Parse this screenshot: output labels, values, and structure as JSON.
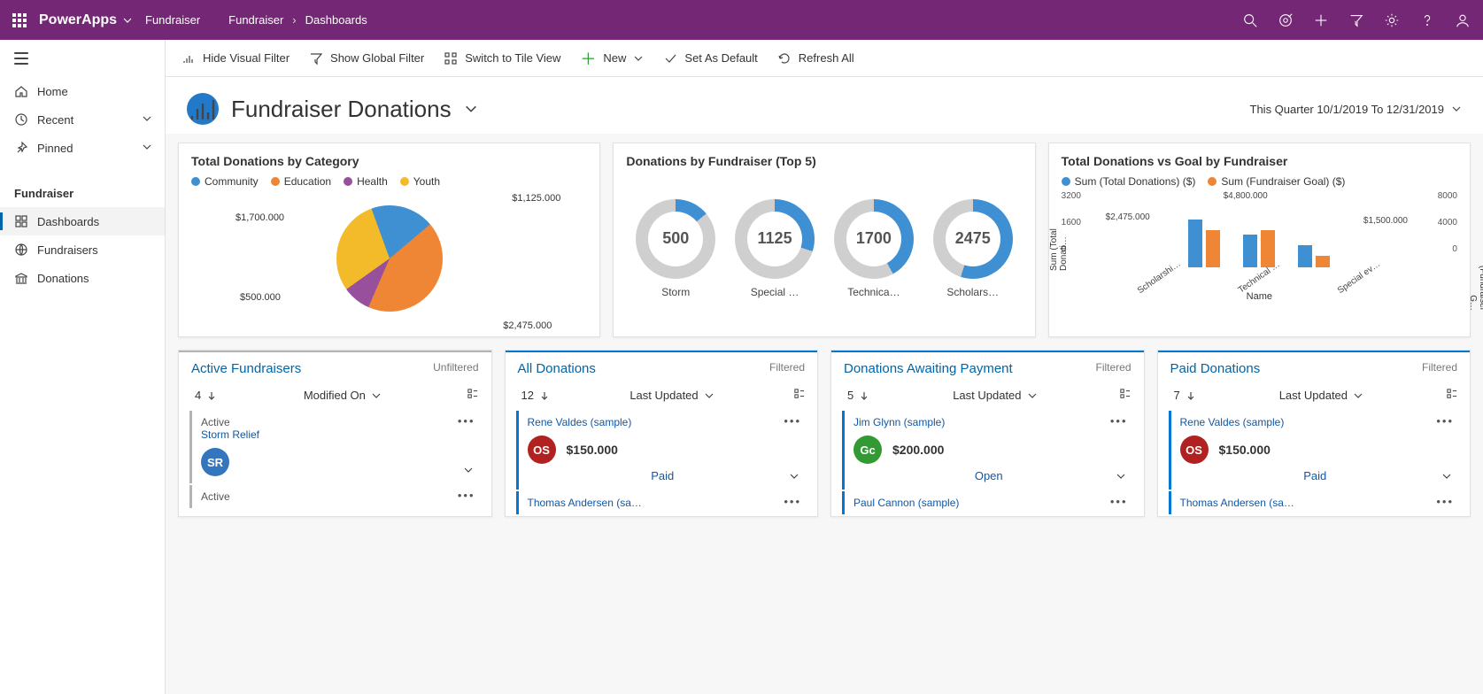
{
  "topbar": {
    "brand": "PowerApps",
    "app_name": "Fundraiser",
    "breadcrumb": [
      "Fundraiser",
      "Dashboards"
    ]
  },
  "sidebar": {
    "home": "Home",
    "recent": "Recent",
    "pinned": "Pinned",
    "section": "Fundraiser",
    "items": [
      {
        "label": "Dashboards"
      },
      {
        "label": "Fundraisers"
      },
      {
        "label": "Donations"
      }
    ]
  },
  "cmdbar": {
    "hide_filter": "Hide Visual Filter",
    "show_global": "Show Global Filter",
    "tile_view": "Switch to Tile View",
    "new": "New",
    "set_default": "Set As Default",
    "refresh": "Refresh All"
  },
  "dashboard": {
    "title": "Fundraiser Donations",
    "range": "This Quarter 10/1/2019 To 12/31/2019"
  },
  "chart_data": [
    {
      "type": "pie",
      "title": "Total Donations by Category",
      "categories": [
        "Community",
        "Education",
        "Health",
        "Youth"
      ],
      "values": [
        1125.0,
        2475.0,
        500.0,
        1700.0
      ],
      "colors": [
        "#3f90d2",
        "#ee8636",
        "#98509d",
        "#f3bb2a"
      ],
      "labels": [
        "$1,125.000",
        "$2,475.000",
        "$500.000",
        "$1,700.000"
      ]
    },
    {
      "type": "donut-multiples",
      "title": "Donations by Fundraiser (Top 5)",
      "items": [
        {
          "label": "Storm",
          "value": 500,
          "pct": 14
        },
        {
          "label": "Special …",
          "value": 1125,
          "pct": 30
        },
        {
          "label": "Technica…",
          "value": 1700,
          "pct": 42
        },
        {
          "label": "Scholars…",
          "value": 2475,
          "pct": 55
        }
      ]
    },
    {
      "type": "bar",
      "title": "Total Donations vs Goal by Fundraiser",
      "xlabel": "Name",
      "ylabel_left": "Sum (Total Donati…",
      "ylabel_right": "Sum (Fundraiser G…",
      "yticks_left": [
        0.0,
        1600.0,
        3200.0
      ],
      "yticks_right": [
        0.0,
        4000.0,
        8000.0
      ],
      "categories": [
        "Scholarshi…",
        "Technical …",
        "Special ev…"
      ],
      "series": [
        {
          "name": "Sum (Total Donations) ($)",
          "values": [
            2475.0,
            1700.0,
            1125.0
          ],
          "color": "#3f90d2"
        },
        {
          "name": "Sum (Fundraiser Goal) ($)",
          "values": [
            4800.0,
            4800.0,
            1500.0
          ],
          "color": "#ee8636"
        }
      ],
      "annotations": [
        "$2,475.000",
        "$4,800.000",
        "$1,500.000"
      ]
    }
  ],
  "lists": [
    {
      "title": "Active Fundraisers",
      "filter": "Unfiltered",
      "count": 4,
      "sort": "Modified On",
      "rows": [
        {
          "header": "Active",
          "name": "Storm Relief",
          "badge": "SR",
          "badge_color": "#3376bd",
          "amount": "",
          "status": ""
        },
        {
          "header": "Active",
          "name": "",
          "badge": "",
          "badge_color": "",
          "amount": "",
          "status": ""
        }
      ],
      "accent": "#b3b3b3"
    },
    {
      "title": "All Donations",
      "filter": "Filtered",
      "count": 12,
      "sort": "Last Updated",
      "rows": [
        {
          "header": "",
          "name": "Rene Valdes (sample)",
          "badge": "OS",
          "badge_color": "#b22121",
          "amount": "$150.000",
          "status": "Paid"
        },
        {
          "header": "",
          "name": "Thomas Andersen (sa…",
          "badge": "",
          "badge_color": "",
          "amount": "",
          "status": ""
        }
      ],
      "accent": "#0078d4"
    },
    {
      "title": "Donations Awaiting Payment",
      "filter": "Filtered",
      "count": 5,
      "sort": "Last Updated",
      "rows": [
        {
          "header": "",
          "name": "Jim Glynn (sample)",
          "badge": "Gc",
          "badge_color": "#339a33",
          "amount": "$200.000",
          "status": "Open"
        },
        {
          "header": "",
          "name": "Paul Cannon (sample)",
          "badge": "",
          "badge_color": "",
          "amount": "",
          "status": ""
        }
      ],
      "accent": "#0078d4"
    },
    {
      "title": "Paid Donations",
      "filter": "Filtered",
      "count": 7,
      "sort": "Last Updated",
      "rows": [
        {
          "header": "",
          "name": "Rene Valdes (sample)",
          "badge": "OS",
          "badge_color": "#b22121",
          "amount": "$150.000",
          "status": "Paid"
        },
        {
          "header": "",
          "name": "Thomas Andersen (sa…",
          "badge": "",
          "badge_color": "",
          "amount": "",
          "status": ""
        }
      ],
      "accent": "#0078d4"
    }
  ]
}
